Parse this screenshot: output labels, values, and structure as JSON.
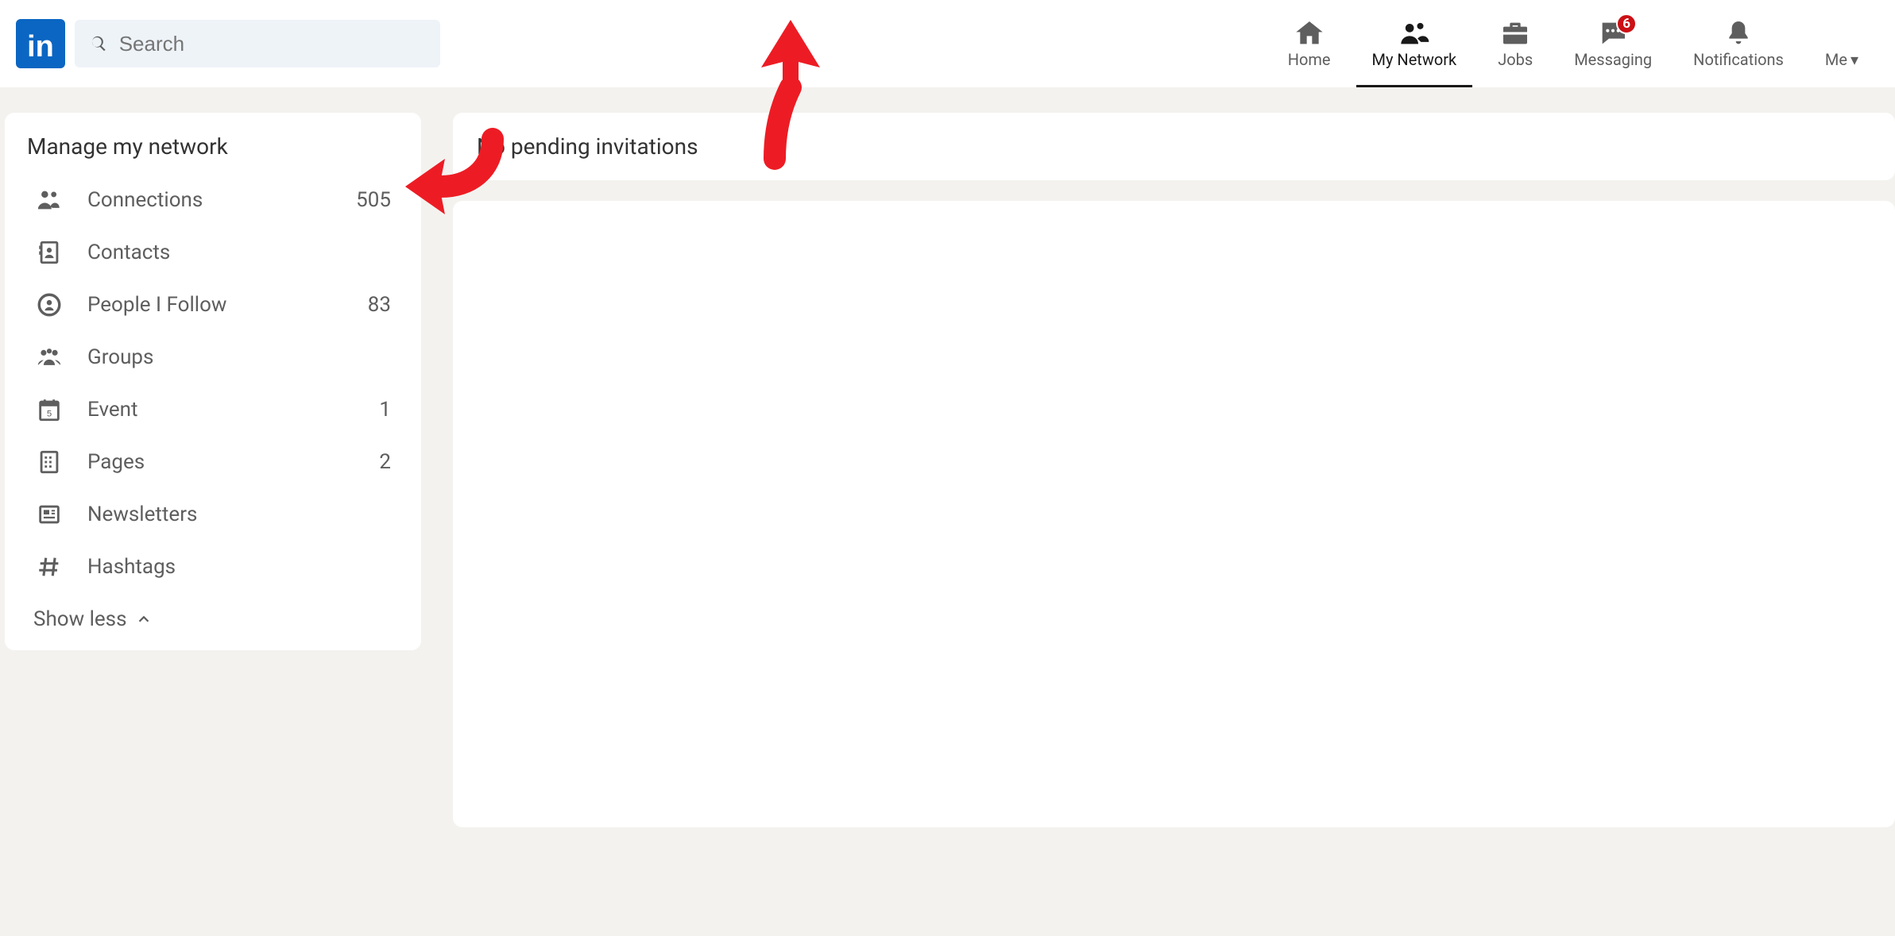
{
  "colors": {
    "brand_blue": "#0a66c2",
    "badge_red": "#cc1016",
    "annotation_red": "#ed1c24"
  },
  "header": {
    "logo_text": "in",
    "search_placeholder": "Search",
    "nav": {
      "home": "Home",
      "my_network": "My Network",
      "jobs": "Jobs",
      "messaging": "Messaging",
      "messaging_badge": "6",
      "notifications": "Notifications",
      "me": "Me"
    }
  },
  "sidebar": {
    "title": "Manage my network",
    "items": [
      {
        "icon": "connections-icon",
        "label": "Connections",
        "count": "505"
      },
      {
        "icon": "contacts-icon",
        "label": "Contacts",
        "count": ""
      },
      {
        "icon": "follow-icon",
        "label": "People I Follow",
        "count": "83"
      },
      {
        "icon": "groups-icon",
        "label": "Groups",
        "count": ""
      },
      {
        "icon": "event-icon",
        "label": "Event",
        "count": "1"
      },
      {
        "icon": "pages-icon",
        "label": "Pages",
        "count": "2"
      },
      {
        "icon": "newsletters-icon",
        "label": "Newsletters",
        "count": ""
      },
      {
        "icon": "hashtags-icon",
        "label": "Hashtags",
        "count": ""
      }
    ],
    "show_less": "Show less"
  },
  "main": {
    "no_invites": "No pending invitations"
  }
}
